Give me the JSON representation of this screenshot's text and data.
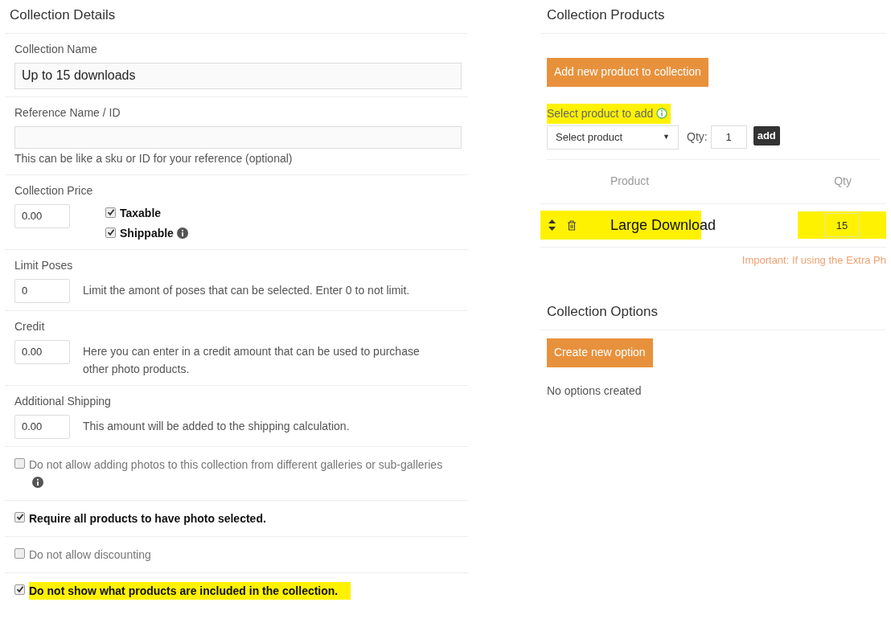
{
  "details": {
    "title": "Collection Details",
    "name": {
      "label": "Collection Name",
      "value": "Up to 15 downloads"
    },
    "reference": {
      "label": "Reference Name / ID",
      "help": "This can be like a sku or ID for your reference (optional)"
    },
    "price": {
      "label": "Collection Price",
      "value": "0.00",
      "checks": [
        {
          "label": "Taxable",
          "checked": true,
          "info": false
        },
        {
          "label": "Shippable",
          "checked": true,
          "info": true
        }
      ]
    },
    "fields": [
      {
        "label": "Limit Poses",
        "value": "0",
        "help": "Limit the amont of poses that can be selected. Enter 0 to not limit."
      },
      {
        "label": "Credit",
        "value": "0.00",
        "help": "Here you can enter in a credit amount that can be used to purchase other photo products."
      },
      {
        "label": "Additional Shipping",
        "value": "0.00",
        "help": "This amount will be added to the shipping calculation."
      }
    ],
    "options": [
      {
        "label": "Do not allow adding photos to this collection from different galleries or sub-galleries",
        "checked": false,
        "info": true,
        "highlighted": false
      },
      {
        "label": "Require all products to have photo selected.",
        "checked": true,
        "info": false,
        "highlighted": false
      },
      {
        "label": "Do not allow discounting",
        "checked": false,
        "info": false,
        "highlighted": false
      },
      {
        "label": "Do not show what products are included in the collection.",
        "checked": true,
        "info": false,
        "highlighted": true
      }
    ]
  },
  "products": {
    "title": "Collection Products",
    "add_button": "Add new product to collection",
    "select_label": {
      "text": "Select product to add",
      "highlighted": true
    },
    "select": {
      "value": "Select product",
      "arrow": "▼"
    },
    "qty_label": "Qty:",
    "qty_value": "1",
    "add": "add",
    "columns": [
      "Product",
      "Qty"
    ],
    "rows": [
      {
        "name": "Large Download",
        "qty": "15",
        "highlighted": true
      }
    ],
    "note": "Important: If using the Extra Ph"
  },
  "options": {
    "title": "Collection Options",
    "button": "Create new option",
    "empty": "No options created"
  }
}
